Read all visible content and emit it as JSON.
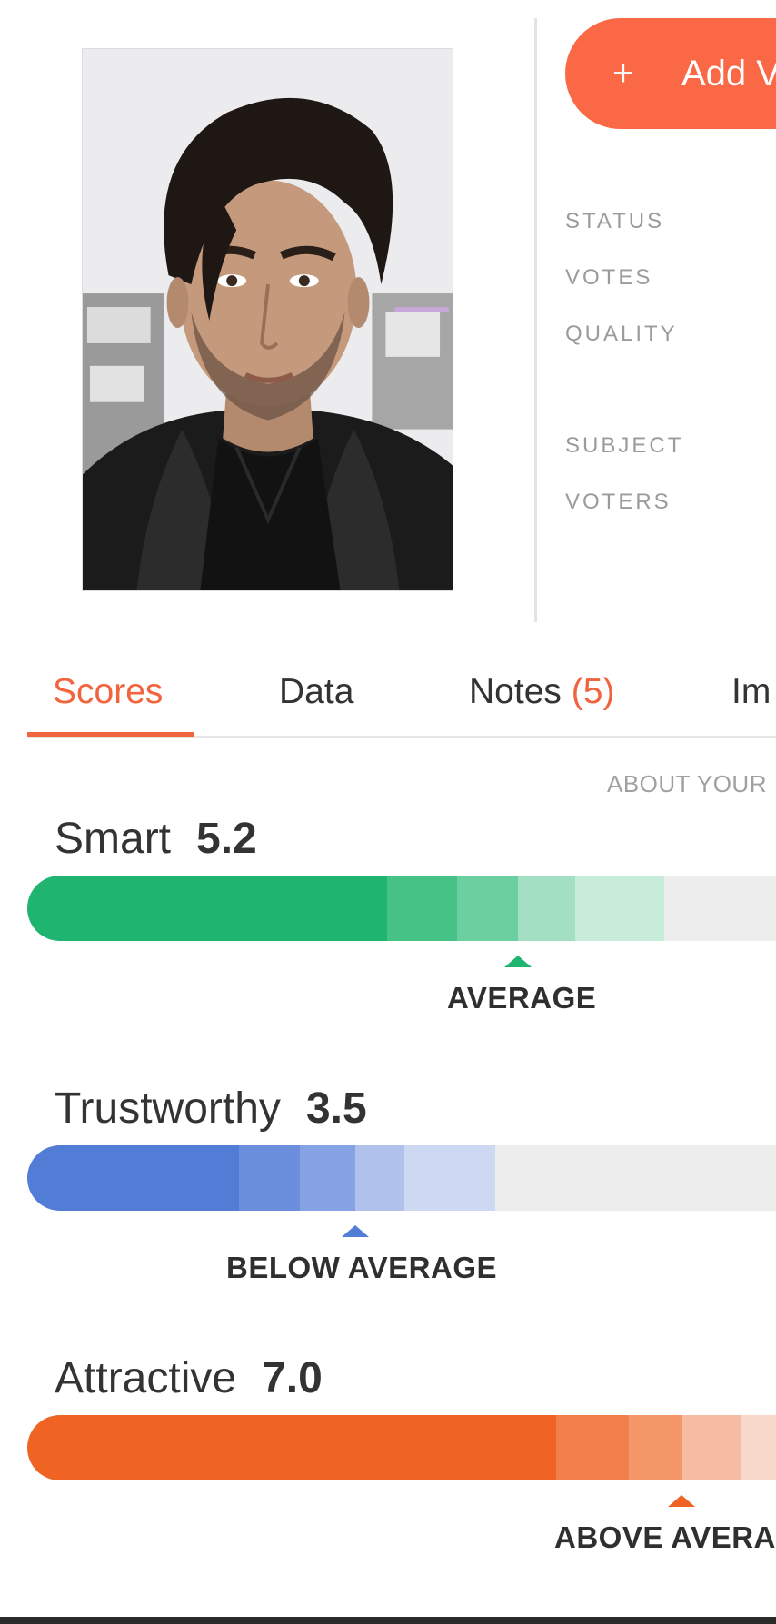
{
  "header": {
    "add_button": {
      "icon": "plus-icon",
      "plus_glyph": "+",
      "label": "Add V"
    },
    "meta_labels": [
      "STATUS",
      "VOTES",
      "QUALITY",
      "SUBJECT",
      "VOTERS"
    ]
  },
  "tabs": [
    {
      "label": "Scores",
      "active": true
    },
    {
      "label": "Data",
      "active": false
    },
    {
      "label": "Notes",
      "count": "(5)",
      "active": false
    },
    {
      "label": "Im",
      "active": false
    }
  ],
  "about_text": "ABOUT YOUR",
  "scores": [
    {
      "name": "Smart",
      "value": "5.2",
      "rating": "AVERAGE",
      "color": "#1fb46f",
      "segment_colors": [
        "#1fb46f",
        "#46c287",
        "#6ccf9f",
        "#a3e0c3",
        "#c8ecda"
      ]
    },
    {
      "name": "Trustworthy",
      "value": "3.5",
      "rating": "BELOW AVERAGE",
      "color": "#517dd7",
      "segment_colors": [
        "#517dd7",
        "#6b8fdd",
        "#85a2e2",
        "#b0c2ec",
        "#cdd8f3"
      ]
    },
    {
      "name": "Attractive",
      "value": "7.0",
      "rating": "ABOVE AVERAGE",
      "color": "#ef6323",
      "segment_colors": [
        "#ef6323",
        "#f17f4b",
        "#f39668",
        "#f5bca3",
        "#f8d8ca"
      ]
    }
  ],
  "colors": {
    "accent": "#fb6846",
    "tab_active": "#f0643e",
    "track": "#ededed"
  }
}
